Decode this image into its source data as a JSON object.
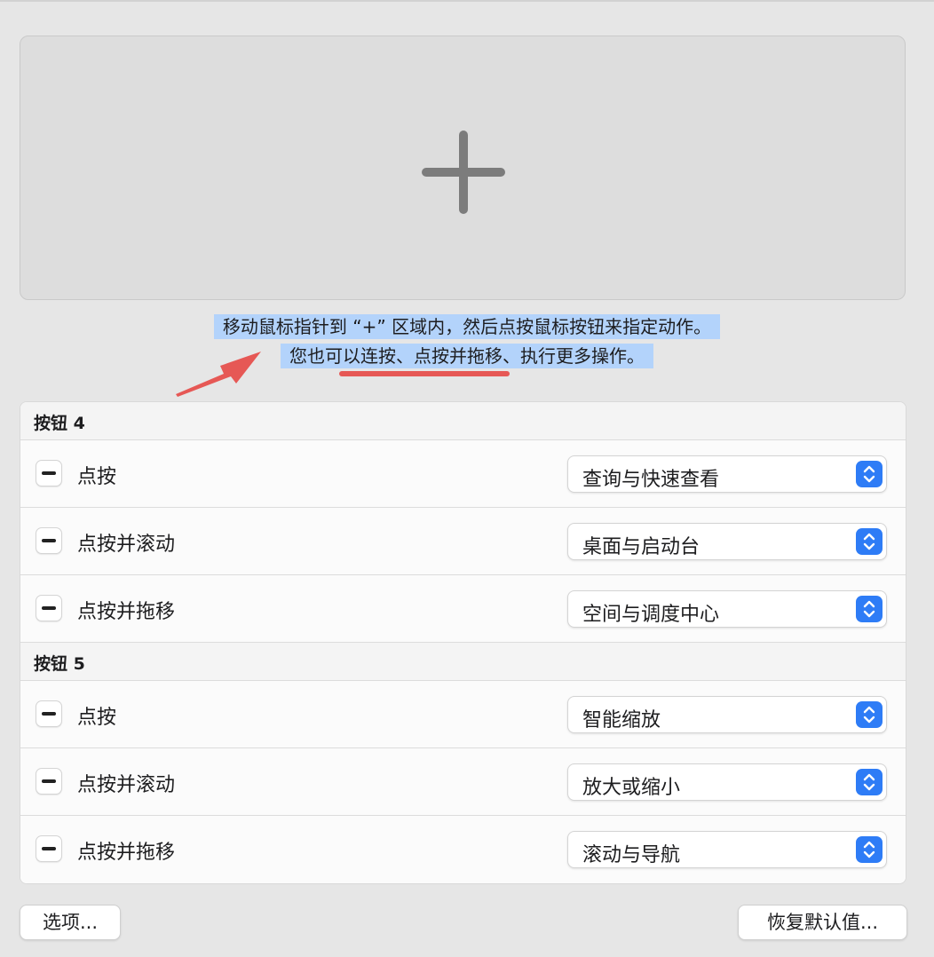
{
  "drop_zone": {
    "icon": "plus-icon"
  },
  "instructions": {
    "line1": "移动鼠标指针到 “+” 区域内，然后点按鼠标按钮来指定动作。",
    "line2": "您也可以连按、点按并拖移、执行更多操作。"
  },
  "annotation": {
    "arrow_color": "#e65855"
  },
  "button4": {
    "label": "按钮 4",
    "actions": [
      {
        "label": "点按",
        "value": "查询与快速查看"
      },
      {
        "label": "点按并滚动",
        "value": "桌面与启动台"
      },
      {
        "label": "点按并拖移",
        "value": "空间与调度中心"
      }
    ]
  },
  "button5": {
    "label": "按钮 5",
    "actions": [
      {
        "label": "点按",
        "value": "智能缩放"
      },
      {
        "label": "点按并滚动",
        "value": "放大或缩小"
      },
      {
        "label": "点按并拖移",
        "value": "滚动与导航"
      }
    ]
  },
  "footer": {
    "options_label": "选项...",
    "restore_label": "恢复默认值..."
  },
  "colors": {
    "accent": "#2e7cf6",
    "selection": "#b3d3fb"
  }
}
